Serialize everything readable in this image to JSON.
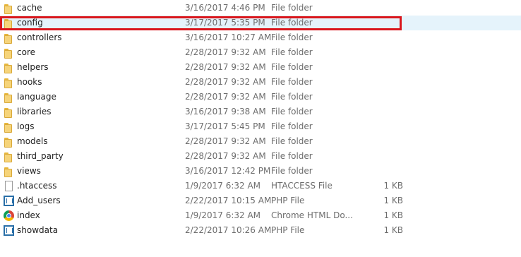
{
  "rows": [
    {
      "name": "cache",
      "date": "3/16/2017 4:46 PM",
      "type": "File folder",
      "size": "",
      "icon": "folder-icon"
    },
    {
      "name": "config",
      "date": "3/17/2017 5:35 PM",
      "type": "File folder",
      "size": "",
      "icon": "folder-icon",
      "highlighted": true
    },
    {
      "name": "controllers",
      "date": "3/16/2017 10:27 AM",
      "type": "File folder",
      "size": "",
      "icon": "folder-icon"
    },
    {
      "name": "core",
      "date": "2/28/2017 9:32 AM",
      "type": "File folder",
      "size": "",
      "icon": "folder-icon"
    },
    {
      "name": "helpers",
      "date": "2/28/2017 9:32 AM",
      "type": "File folder",
      "size": "",
      "icon": "folder-icon"
    },
    {
      "name": "hooks",
      "date": "2/28/2017 9:32 AM",
      "type": "File folder",
      "size": "",
      "icon": "folder-icon"
    },
    {
      "name": "language",
      "date": "2/28/2017 9:32 AM",
      "type": "File folder",
      "size": "",
      "icon": "folder-icon"
    },
    {
      "name": "libraries",
      "date": "3/16/2017 9:38 AM",
      "type": "File folder",
      "size": "",
      "icon": "folder-icon"
    },
    {
      "name": "logs",
      "date": "3/17/2017 5:45 PM",
      "type": "File folder",
      "size": "",
      "icon": "folder-icon"
    },
    {
      "name": "models",
      "date": "2/28/2017 9:32 AM",
      "type": "File folder",
      "size": "",
      "icon": "folder-icon"
    },
    {
      "name": "third_party",
      "date": "2/28/2017 9:32 AM",
      "type": "File folder",
      "size": "",
      "icon": "folder-icon"
    },
    {
      "name": "views",
      "date": "3/16/2017 12:42 PM",
      "type": "File folder",
      "size": "",
      "icon": "folder-icon"
    },
    {
      "name": ".htaccess",
      "date": "1/9/2017 6:32 AM",
      "type": "HTACCESS File",
      "size": "1 KB",
      "icon": "file-icon"
    },
    {
      "name": "Add_users",
      "date": "2/22/2017 10:15 AM",
      "type": "PHP File",
      "size": "1 KB",
      "icon": "php-icon"
    },
    {
      "name": "index",
      "date": "1/9/2017 6:32 AM",
      "type": "Chrome HTML Do...",
      "size": "1 KB",
      "icon": "chrome-icon"
    },
    {
      "name": "showdata",
      "date": "2/22/2017 10:26 AM",
      "type": "PHP File",
      "size": "1 KB",
      "icon": "php-icon"
    }
  ],
  "colors": {
    "highlight_border": "#d9161c",
    "selected_row": "#e5f3fb"
  }
}
